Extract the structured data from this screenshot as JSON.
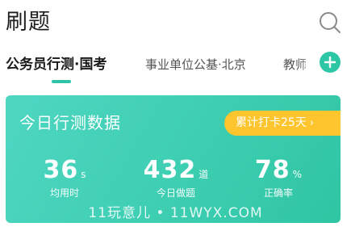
{
  "header": {
    "title": "刷题",
    "search_icon": "search-icon"
  },
  "tabs": [
    {
      "label": "公务员行测·国考",
      "active": true
    },
    {
      "label": "事业单位公基·北京",
      "active": false
    },
    {
      "label": "教师",
      "active": false
    }
  ],
  "add_icon": "plus-circle-icon",
  "card": {
    "title": "今日行测数据",
    "streak_label": "累计打卡25天",
    "streak_chevron": "›",
    "stats": [
      {
        "value": "36",
        "unit": "s",
        "label": "均用时"
      },
      {
        "value": "432",
        "unit": "道",
        "label": "今日做题"
      },
      {
        "value": "78",
        "unit": "%",
        "label": "正确率"
      }
    ]
  },
  "watermark": "11玩意儿 • 11WYX.COM",
  "colors": {
    "accent": "#2ec4a5",
    "badge": "#ffc52e",
    "card_gradient_start": "#4fd6c2",
    "card_gradient_end": "#2fc5a3"
  }
}
